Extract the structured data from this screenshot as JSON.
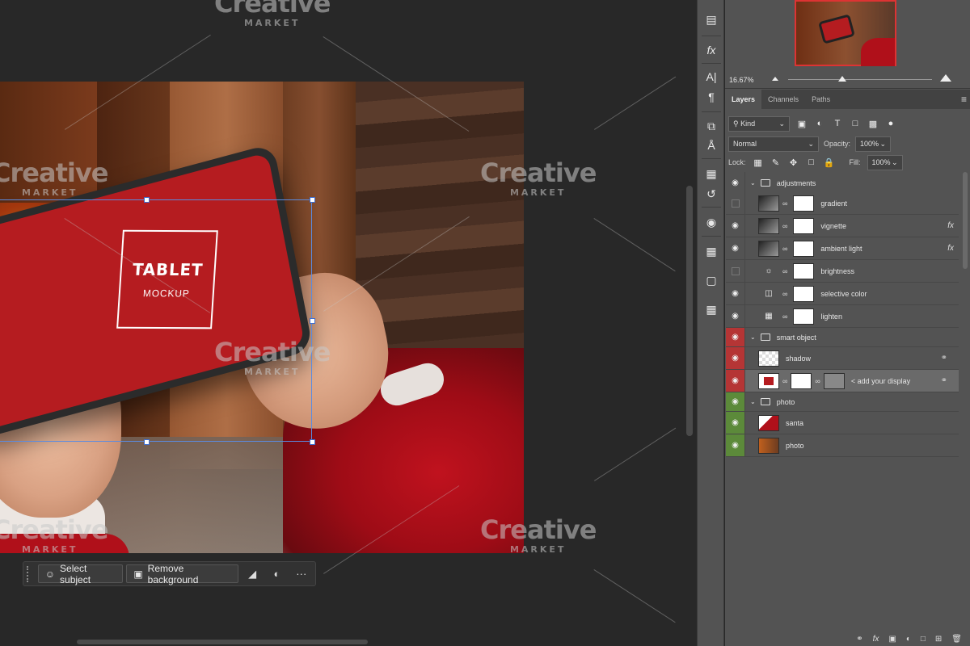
{
  "canvas": {
    "tablet_logo_title": "TABLET",
    "tablet_logo_subtitle": "MOCKUP",
    "watermark_brand": "Creative",
    "watermark_sub": "MARKET"
  },
  "contextual_task_bar": {
    "select_subject_label": "Select subject",
    "remove_background_label": "Remove background",
    "more_label": "···"
  },
  "navigator": {
    "zoom_value": "16.67%"
  },
  "layers_panel": {
    "tabs": [
      "Layers",
      "Channels",
      "Paths"
    ],
    "filter_kind": "Kind",
    "blend_mode": "Normal",
    "opacity_label": "Opacity:",
    "opacity_value": "100%",
    "lock_label": "Lock:",
    "fill_label": "Fill:",
    "fill_value": "100%",
    "layers": [
      {
        "name": "adjustments",
        "type": "group",
        "visible": true,
        "color": "none"
      },
      {
        "name": "gradient",
        "type": "adjustment",
        "visible": false,
        "color": "none"
      },
      {
        "name": "vignette",
        "type": "adjustment",
        "visible": true,
        "color": "none",
        "fx": true
      },
      {
        "name": "ambient light",
        "type": "adjustment",
        "visible": true,
        "color": "none",
        "fx": true
      },
      {
        "name": "brightness",
        "type": "adjustment",
        "visible": false,
        "color": "none"
      },
      {
        "name": "selective color",
        "type": "adjustment",
        "visible": true,
        "color": "none"
      },
      {
        "name": "lighten",
        "type": "adjustment",
        "visible": true,
        "color": "none"
      },
      {
        "name": "smart object",
        "type": "group",
        "visible": true,
        "color": "red"
      },
      {
        "name": "shadow",
        "type": "layer",
        "visible": true,
        "color": "red",
        "linked": true
      },
      {
        "name": "< add your display",
        "type": "smart-object",
        "visible": true,
        "color": "red",
        "linked": true,
        "selected": true
      },
      {
        "name": "photo",
        "type": "group",
        "visible": true,
        "color": "green"
      },
      {
        "name": "santa",
        "type": "layer",
        "visible": true,
        "color": "green"
      },
      {
        "name": "photo",
        "type": "layer",
        "visible": true,
        "color": "green"
      }
    ],
    "fx_label": "fx"
  }
}
